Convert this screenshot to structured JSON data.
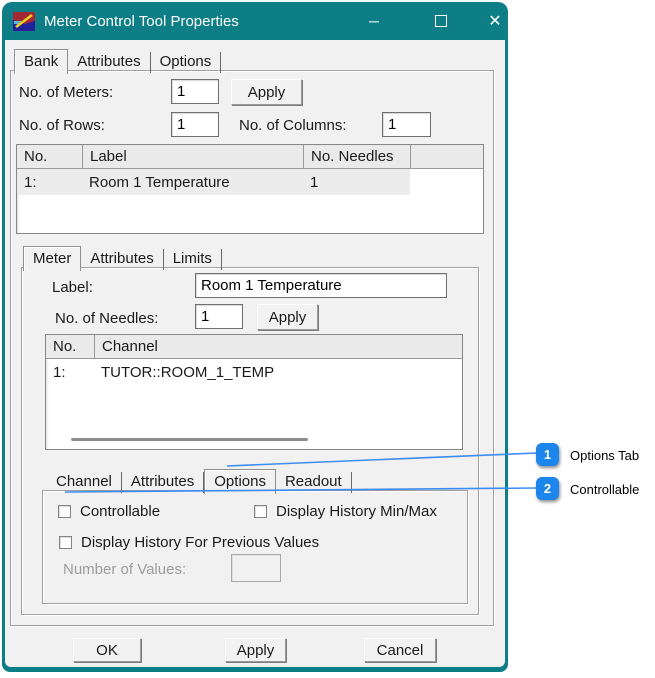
{
  "window": {
    "title": "Meter Control Tool Properties",
    "minimize_glyph": "─",
    "close_glyph": "✕"
  },
  "colors": {
    "titlebar_teal": "#0d7e86",
    "callout_badge_blue": "#1d86ec",
    "callout_line_blue": "#3b8df0",
    "dialog_background": "#f1f1f1"
  },
  "bank_tabs": {
    "items": [
      {
        "label": "Bank",
        "active": true
      },
      {
        "label": "Attributes",
        "active": false
      },
      {
        "label": "Options",
        "active": false
      }
    ]
  },
  "bank": {
    "meters_label": "No. of Meters:",
    "meters_value": "1",
    "apply_label": "Apply",
    "rows_label": "No. of Rows:",
    "rows_value": "1",
    "columns_label": "No. of Columns:",
    "columns_value": "1",
    "list": {
      "headers": [
        "No.",
        "Label",
        "No. Needles"
      ],
      "row": {
        "no": "1:",
        "label": "Room 1 Temperature",
        "needles": "1"
      }
    }
  },
  "meter_tabs": {
    "items": [
      {
        "label": "Meter",
        "active": true
      },
      {
        "label": "Attributes",
        "active": false
      },
      {
        "label": "Limits",
        "active": false
      }
    ]
  },
  "meter": {
    "label_label": "Label:",
    "label_value": "Room 1 Temperature",
    "needles_label": "No. of Needles:",
    "needles_value": "1",
    "apply_label": "Apply",
    "list": {
      "headers": [
        "No.",
        "Channel"
      ],
      "row": {
        "no": "1:",
        "channel": "TUTOR::ROOM_1_TEMP"
      }
    }
  },
  "channel_tabs": {
    "items": [
      {
        "label": "Channel",
        "active": false
      },
      {
        "label": "Attributes",
        "active": false
      },
      {
        "label": "Options",
        "active": true
      },
      {
        "label": "Readout",
        "active": false
      }
    ]
  },
  "options": {
    "controllable_label": "Controllable",
    "history_minmax_label": "Display History Min/Max",
    "history_prev_label": "Display History For Previous Values",
    "num_values_label": "Number of Values:",
    "num_values_value": ""
  },
  "footer": {
    "ok_label": "OK",
    "apply_label": "Apply",
    "cancel_label": "Cancel"
  },
  "callouts": [
    {
      "number": "1",
      "label": "Options Tab"
    },
    {
      "number": "2",
      "label": "Controllable"
    }
  ]
}
